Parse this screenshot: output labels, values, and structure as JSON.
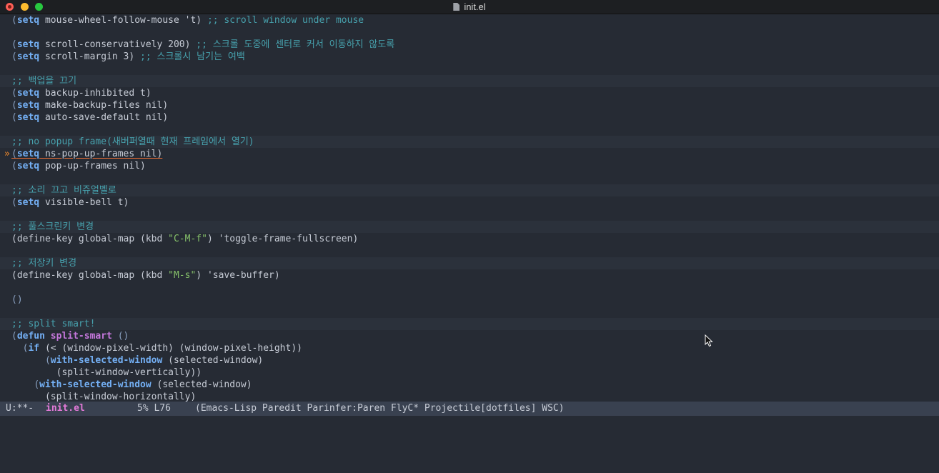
{
  "window": {
    "title": "init.el"
  },
  "editor": {
    "lines": {
      "l1": {
        "kw": "setq",
        "rest": " mouse-wheel-follow-mouse 't) ",
        "comment": ";; scroll window under mouse"
      },
      "l3": {
        "kw": "setq",
        "rest": " scroll-conservatively 200) ",
        "comment": ";; 스크롤 도중에 센터로 커서 이동하지 않도록"
      },
      "l4": {
        "kw": "setq",
        "rest": " scroll-margin 3) ",
        "comment": ";; 스크롤시 남기는 여백"
      },
      "l6": {
        "comment": ";; 백업을 끄기"
      },
      "l7": {
        "kw": "setq",
        "rest": " backup-inhibited t)"
      },
      "l8": {
        "kw": "setq",
        "rest": " make-backup-files nil)"
      },
      "l9": {
        "kw": "setq",
        "rest": " auto-save-default nil)"
      },
      "l11": {
        "comment": ";; no popup frame(새버퍼열때 현재 프레임에서 열기)"
      },
      "l12": {
        "kw": "setq",
        "rest": " ns-pop-up-frames nil)",
        "fringe": "»"
      },
      "l13": {
        "kw": "setq",
        "rest": " pop-up-frames nil)"
      },
      "l15": {
        "comment": ";; 소리 끄고 비쥬얼벨로"
      },
      "l16": {
        "kw": "setq",
        "rest": " visible-bell t)"
      },
      "l18": {
        "comment": ";; 풀스크린키 변경"
      },
      "l19": {
        "pre": "(define-key global-map (kbd ",
        "str": "\"C-M-f\"",
        "post": ") 'toggle-frame-fullscreen)"
      },
      "l21": {
        "comment": ";; 저장키 변경"
      },
      "l22": {
        "pre": "(define-key global-map (kbd ",
        "str": "\"M-s\"",
        "post": ") 'save-buffer)"
      },
      "l24": {
        "text": "()"
      },
      "l26": {
        "comment": ";; split smart!"
      },
      "l27": {
        "kw": "defun",
        "fname": "split-smart",
        "post": " ()"
      },
      "l28": {
        "indent": "  ",
        "kw": "if",
        "pre": " (< (window-pixel-width) (window-pixel-height))"
      },
      "l29": {
        "indent": "      ",
        "kw": "with-selected-window",
        "post": " (selected-window)"
      },
      "l30": {
        "indent": "        ",
        "text": "(split-window-vertically))"
      },
      "l31": {
        "indent": "    ",
        "kw": "with-selected-window",
        "post": " (selected-window)"
      },
      "l32": {
        "indent": "      ",
        "text": "(split-window-horizontally)"
      }
    }
  },
  "modeline": {
    "state": "U:**-",
    "buffer": "init.el",
    "position": "5% L76",
    "modes": "(Emacs-Lisp Paredit Parinfer:Paren FlyC* Projectile[dotfiles] WSC)"
  },
  "icons": {
    "file": "document-icon",
    "pointer": "mouse-pointer-icon"
  },
  "colors": {
    "background": "#262b34",
    "keyword": "#74b0f5",
    "function_name": "#c678dd",
    "comment": "#47a1ad",
    "string": "#86c16a",
    "modeline_bg": "#394150",
    "buffer_name": "#e37ad9"
  }
}
